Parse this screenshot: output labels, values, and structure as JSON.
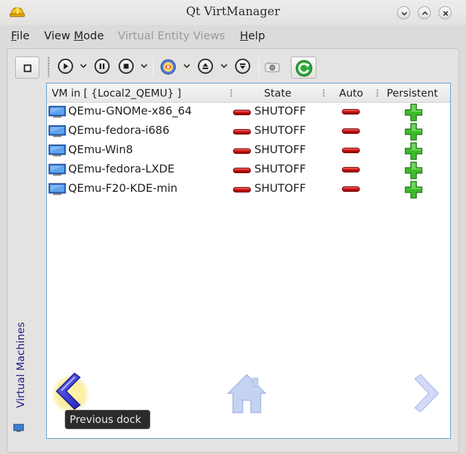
{
  "window": {
    "title": "Qt VirtManager",
    "icon": "hard-hat-icon",
    "controls": [
      "minimize-icon",
      "maximize-icon",
      "close-icon"
    ]
  },
  "menubar": {
    "items": [
      {
        "label": "File",
        "accel": "F",
        "rest": "ile",
        "enabled": true
      },
      {
        "label": "View Mode",
        "accel": "M",
        "pre": "View ",
        "rest": "ode",
        "enabled": true
      },
      {
        "label": "Virtual Entity Views",
        "enabled": false
      },
      {
        "label": "Help",
        "accel": "H",
        "rest": "elp",
        "enabled": true
      }
    ]
  },
  "toolbar": {
    "icons": [
      "dock-toggle-icon",
      "start-icon",
      "pause-icon",
      "stop-icon",
      "virt-viewer-icon",
      "eject-icon",
      "save-icon",
      "snapshot-icon",
      "refresh-icon"
    ]
  },
  "side_dock": {
    "label": "Virtual Machines"
  },
  "table": {
    "columns": {
      "name": "VM in [ {Local2_QEMU} ]",
      "state": "State",
      "auto": "Auto",
      "persistent": "Persistent"
    },
    "rows": [
      {
        "name": "QEmu-GNOMe-x86_64",
        "state": "SHUTOFF",
        "auto": false,
        "persistent": true
      },
      {
        "name": "QEmu-fedora-i686",
        "state": "SHUTOFF",
        "auto": false,
        "persistent": true
      },
      {
        "name": "QEmu-Win8",
        "state": "SHUTOFF",
        "auto": false,
        "persistent": true
      },
      {
        "name": "QEmu-fedora-LXDE",
        "state": "SHUTOFF",
        "auto": false,
        "persistent": true
      },
      {
        "name": "QEmu-F20-KDE-min",
        "state": "SHUTOFF",
        "auto": false,
        "persistent": true
      }
    ]
  },
  "navigation": {
    "tooltip": "Previous dock",
    "icons": [
      "previous-dock-icon",
      "home-icon",
      "next-dock-icon"
    ]
  },
  "colors": {
    "accent_blue": "#3b3bd0",
    "link_blue": "#1d1d8a",
    "shutoff_red": "#c41010",
    "persistent_green": "#2f9a1e"
  }
}
